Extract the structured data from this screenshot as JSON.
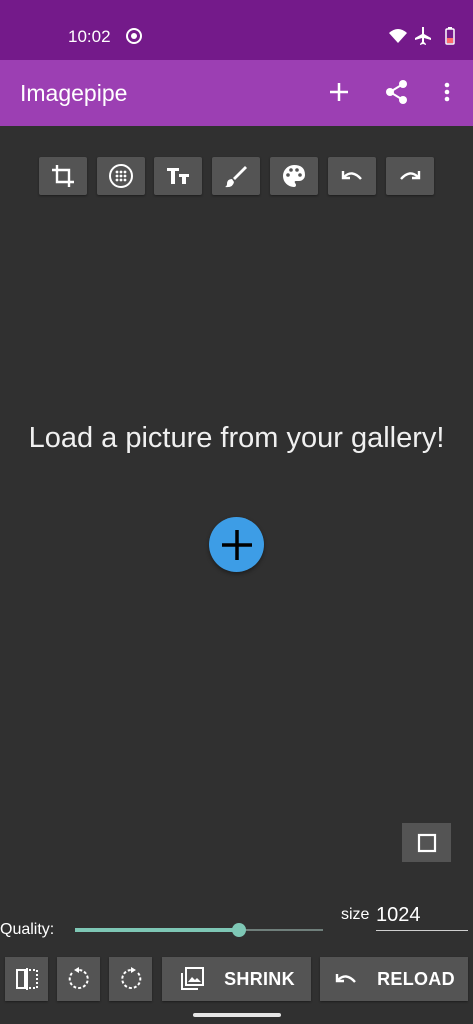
{
  "status_bar": {
    "time": "10:02",
    "icons": [
      "media-record-icon",
      "wifi-icon",
      "airplane-icon",
      "battery-icon"
    ]
  },
  "app_bar": {
    "title": "Imagepipe",
    "actions": [
      "add-icon",
      "share-icon",
      "more-vert-icon"
    ]
  },
  "toolbar": {
    "tools": [
      "crop-icon",
      "blur-icon",
      "text-icon",
      "brush-icon",
      "palette-icon",
      "undo-icon",
      "redo-icon"
    ]
  },
  "main": {
    "message": "Load a picture from your gallery!",
    "fab_icon": "add-icon",
    "square_icon": "square-icon"
  },
  "controls": {
    "quality_label": "Quality:",
    "quality_value": 0.66,
    "size_label": "size",
    "size_value": "1024"
  },
  "bottom_bar": {
    "shrink_label": "SHRINK",
    "reload_label": "RELOAD",
    "icons": [
      "flip-icon",
      "rotate-left-icon",
      "rotate-right-icon",
      "gallery-icon",
      "reload-undo-icon"
    ]
  },
  "colors": {
    "status_bar": "#741a8a",
    "app_bar": "#9c3fb3",
    "background": "#303030",
    "button": "#545454",
    "fab": "#3d9de6",
    "accent": "#7ec7b5"
  }
}
